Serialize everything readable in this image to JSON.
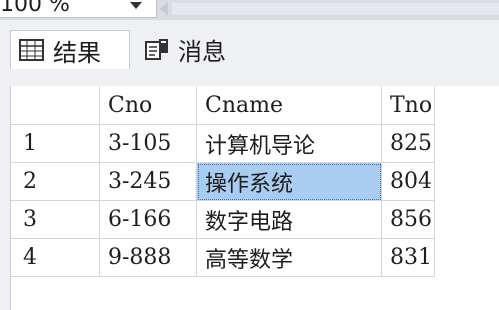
{
  "zoom": {
    "value": "100 %"
  },
  "tabs": [
    {
      "label": "结果",
      "icon": "grid-icon"
    },
    {
      "label": "消息",
      "icon": "messages-icon"
    }
  ],
  "grid": {
    "columns": [
      "",
      "Cno",
      "Cname",
      "Tno"
    ],
    "rows": [
      {
        "num": "1",
        "Cno": "3-105",
        "Cname": "计算机导论",
        "Tno": "825"
      },
      {
        "num": "2",
        "Cno": "3-245",
        "Cname": "操作系统",
        "Tno": "804"
      },
      {
        "num": "3",
        "Cno": "6-166",
        "Cname": "数字电路",
        "Tno": "856"
      },
      {
        "num": "4",
        "Cno": "9-888",
        "Cname": "高等数学",
        "Tno": "831"
      }
    ],
    "selected_color": "#a8cdf0"
  }
}
